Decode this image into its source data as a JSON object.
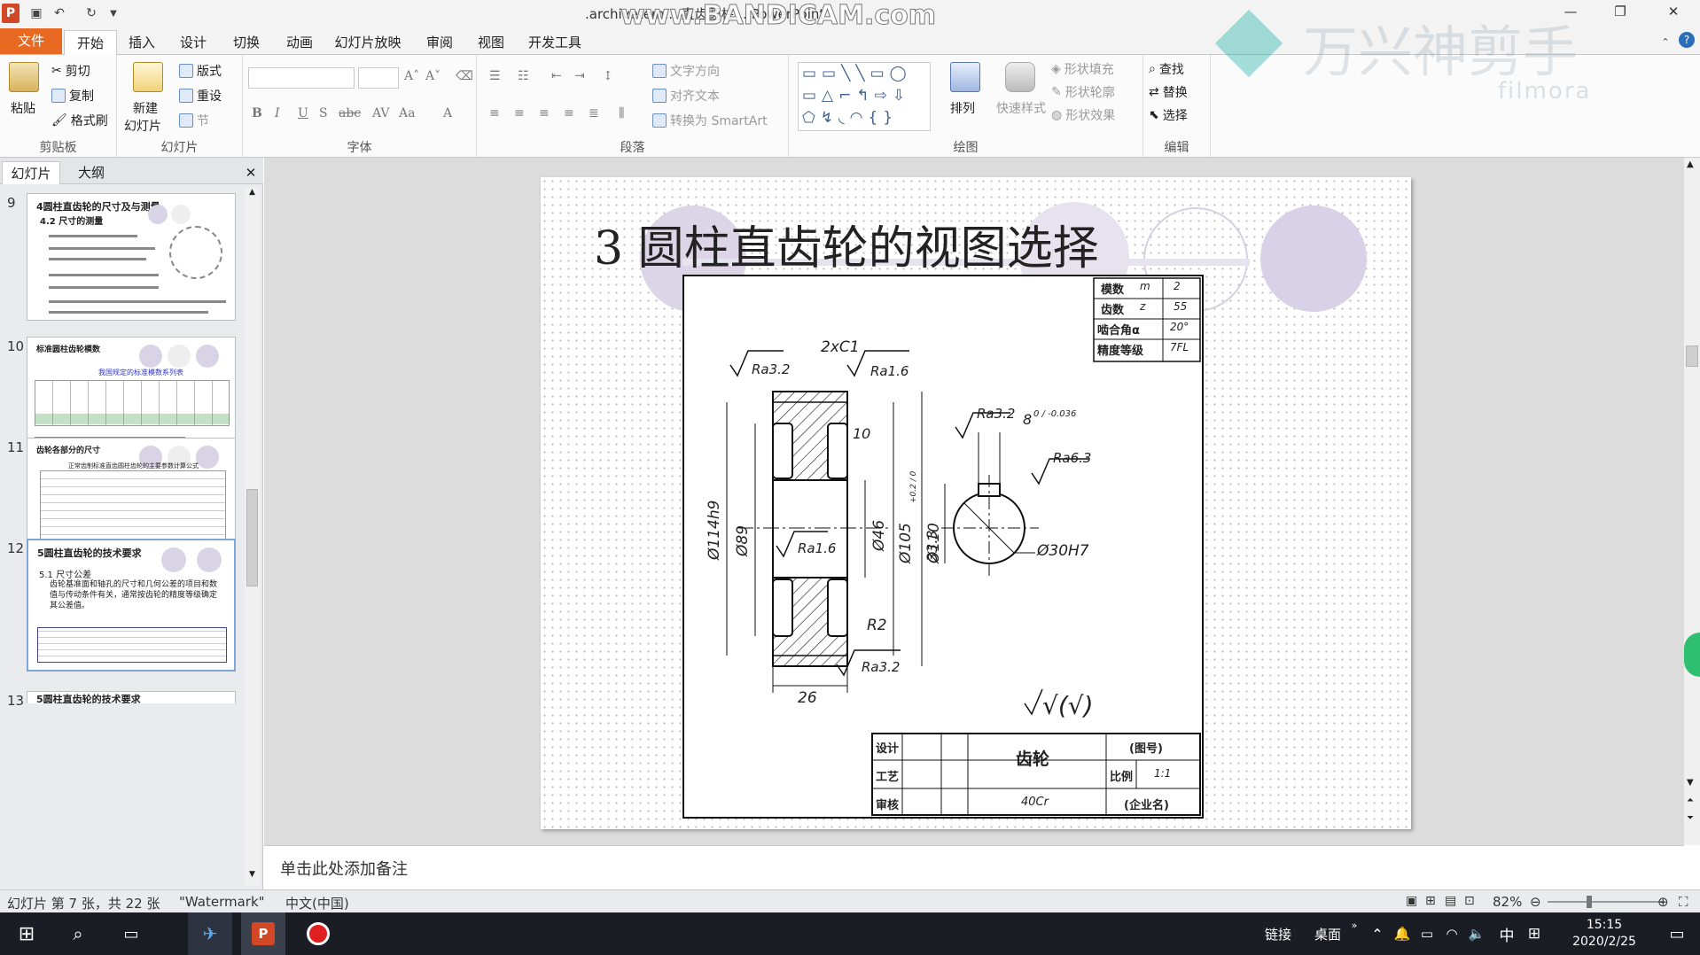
{
  "window": {
    "title": ".archivetem... 直齿圆柱... PowerPoint",
    "ppt_badge": "P"
  },
  "ribbon_tabs": [
    "文件",
    "开始",
    "插入",
    "设计",
    "切换",
    "动画",
    "幻灯片放映",
    "审阅",
    "视图",
    "开发工具"
  ],
  "ribbon": {
    "clipboard": {
      "label": "剪贴板",
      "paste": "粘贴",
      "cut": "剪切",
      "copy": "复制",
      "format_painter": "格式刷"
    },
    "slides": {
      "label": "幻灯片",
      "new_slide": "新建",
      "new_slide2": "幻灯片",
      "layout": "版式",
      "reset": "重设",
      "section": "节"
    },
    "font": {
      "label": "字体"
    },
    "paragraph": {
      "label": "段落",
      "text_direction": "文字方向",
      "align_text": "对齐文本",
      "smartart": "转换为 SmartArt"
    },
    "drawing": {
      "label": "绘图",
      "arrange": "排列",
      "quick_styles": "快速样式",
      "shape_fill": "形状填充",
      "shape_outline": "形状轮廓",
      "shape_effects": "形状效果"
    },
    "editing": {
      "label": "编辑",
      "find": "查找",
      "replace": "替换",
      "select": "选择"
    }
  },
  "left_pane": {
    "tabs": [
      "幻灯片",
      "大纲"
    ],
    "close": "✕",
    "thumbnails": [
      {
        "number": "9",
        "title": "4圆柱直齿轮的尺寸及与测量",
        "subtitle": "4.2 尺寸的测量"
      },
      {
        "number": "10",
        "title": "标准圆柱齿轮模数",
        "subtitle": "我国规定的标准模数系列表"
      },
      {
        "number": "11",
        "title": "齿轮各部分的尺寸",
        "subtitle": "正常齿制标准直齿圆柱齿轮的主要参数计算公式"
      },
      {
        "number": "12",
        "title": "5圆柱直齿轮的技术要求",
        "subtitle": "5.1 尺寸公差",
        "body": "齿轮基准面和轴孔的尺寸和几何公差的项目和数值与传动条件有关，通常按齿轮的精度等级确定其公差值。"
      },
      {
        "number": "13",
        "title": "5圆柱直齿轮的技术要求"
      }
    ]
  },
  "slide": {
    "title": "3 圆柱直齿轮的视图选择",
    "params_table": [
      [
        "模数",
        "m",
        "2"
      ],
      [
        "齿数",
        "z",
        "55"
      ],
      [
        "啮合角α",
        "",
        "20°"
      ],
      [
        "精度等级",
        "",
        "7FL"
      ]
    ],
    "title_block": {
      "design": "设计",
      "process": "工艺",
      "review": "审核",
      "part_name": "齿轮",
      "drawing_no": "(图号)",
      "scale_label": "比例",
      "scale_value": "1:1",
      "material": "40Cr",
      "school": "(企业名)"
    },
    "dims": {
      "chamfer": "2xC1",
      "ra32_top": "Ra3.2",
      "ra16_top": "Ra1.6",
      "width_10": "10",
      "d_outer": "Ø114h9",
      "d_89": "Ø89",
      "d_46": "Ø46",
      "d_105": "Ø105",
      "d_110": "Ø110",
      "ra16_mid": "Ra1.6",
      "r2": "R2",
      "width_26": "26",
      "ra32_bottom": "Ra3.2",
      "ra32_key": "Ra3.2",
      "key_width": "8",
      "key_tol": "0 / -0.036",
      "ra63": "Ra6.3",
      "key_depth": "33.3",
      "key_depth_tol": "+0.2 / 0",
      "bore": "Ø30H7",
      "roughness_note": "√(√)"
    }
  },
  "notes": {
    "placeholder": "单击此处添加备注"
  },
  "status": {
    "slide_info": "幻灯片 第 7 张，共 22 张",
    "theme": "\"Watermark\"",
    "language": "中文(中国)",
    "zoom": "82%"
  },
  "taskbar": {
    "link": "链接",
    "desktop": "桌面",
    "ime": "中",
    "time": "15:15",
    "date": "2020/2/25"
  },
  "watermarks": {
    "recorder": "www.BANDICAM.com",
    "brand_cn": "万兴神剪手",
    "brand_en": "filmora"
  },
  "colors": {
    "file_tab": "#e86a22",
    "slide_circle": "#d9d3e6",
    "taskbar": "#1a1d24"
  }
}
